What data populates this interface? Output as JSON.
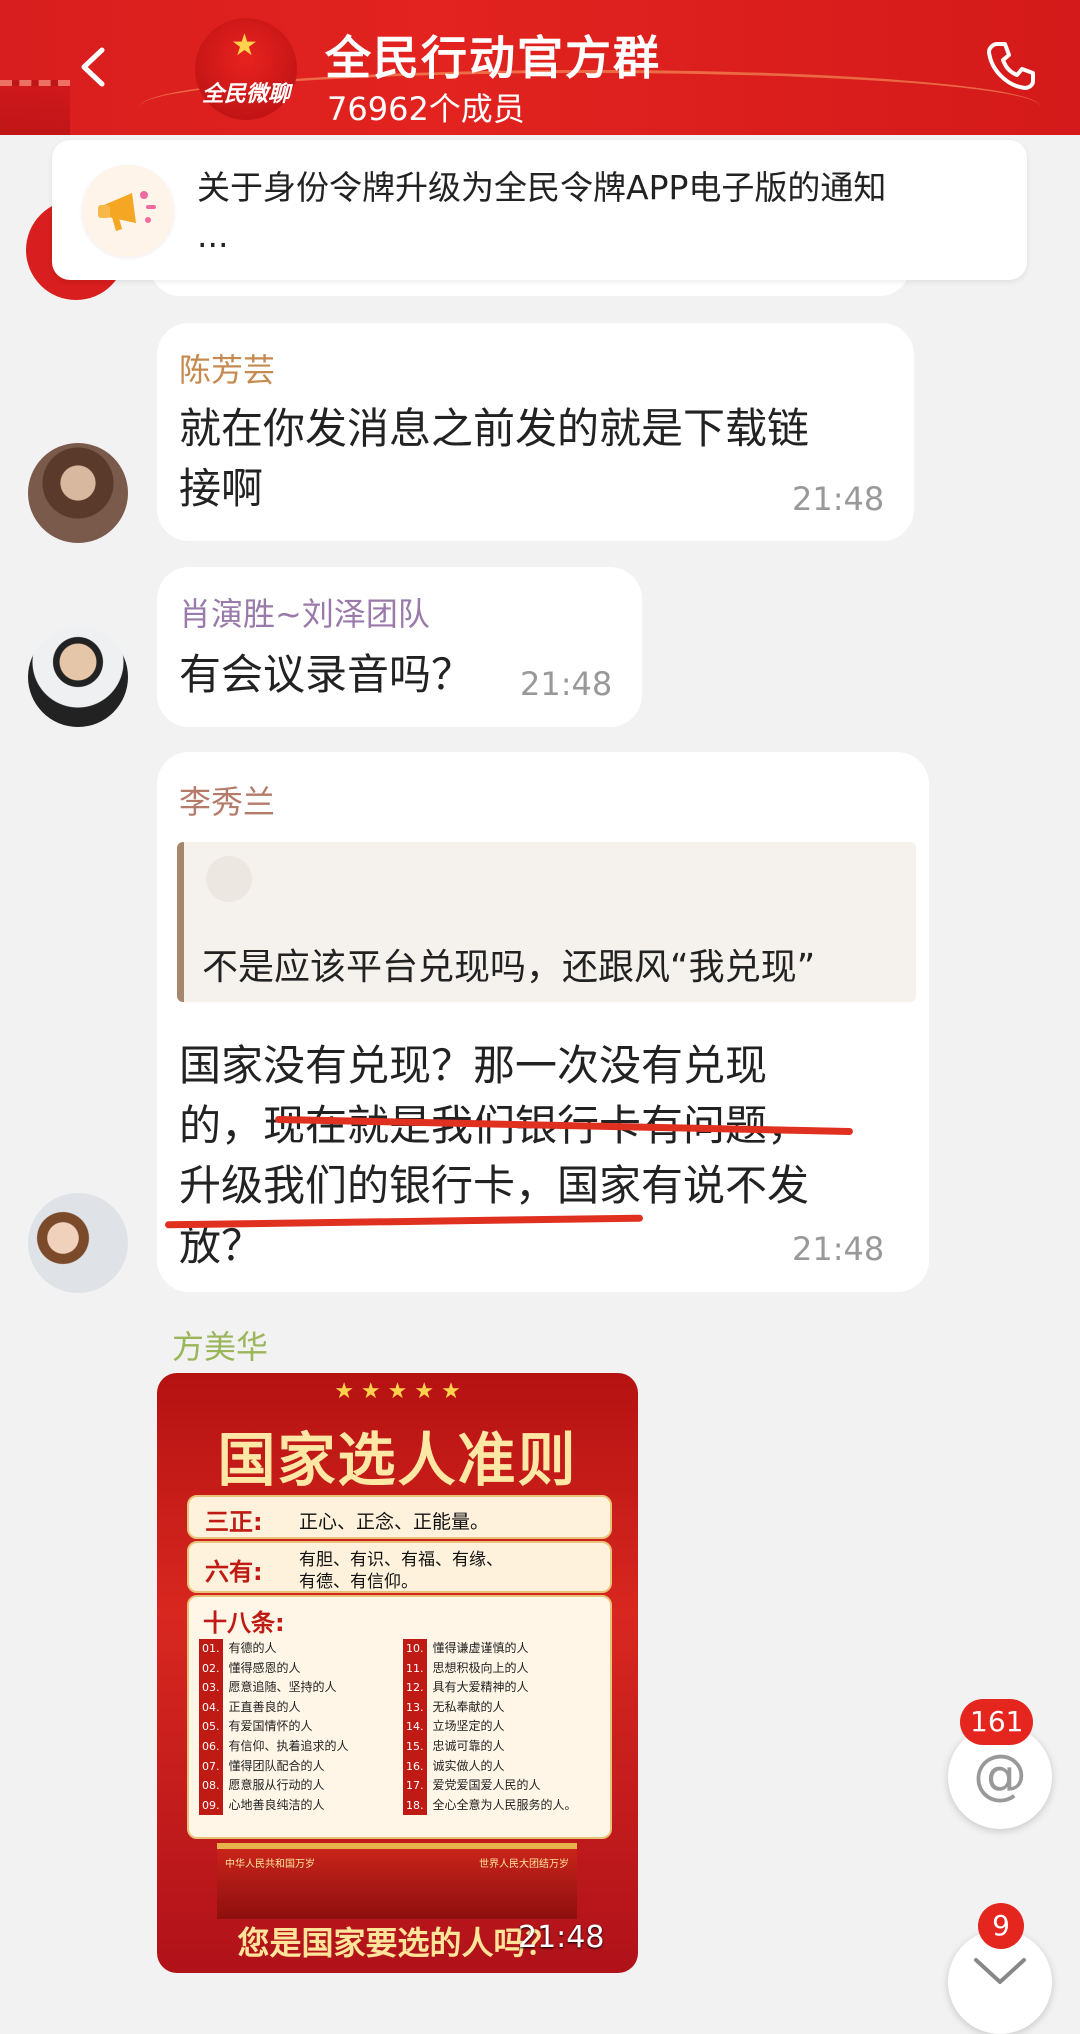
{
  "header": {
    "back_icon": "chevron-left-icon",
    "logo_text": "全民微聊",
    "title": "全民行动官方群",
    "member_count": "76962个成员",
    "phone_icon": "phone-icon",
    "colors": {
      "bar": "#d81e1e",
      "text": "#ffffff"
    }
  },
  "notice": {
    "icon": "megaphone-icon",
    "text": "关于身份令牌升级为全民令牌APP电子版的通知",
    "ellipsis": "..."
  },
  "messages": [
    {
      "sender": "陈芳芸",
      "sender_color": "#c48a4f",
      "lines": [
        "就在你发消息之前发的就是下载链",
        "接啊"
      ],
      "time": "21:48"
    },
    {
      "sender": "肖演胜~刘泽团队",
      "sender_color": "#9a7aaa",
      "text": "有会议录音吗？",
      "time": "21:48"
    },
    {
      "sender": "李秀兰",
      "sender_color": "#b47a6a",
      "quote": "不是应该平台兑现吗，还跟风“我兑现”",
      "lines": [
        "国家没有兑现？那一次没有兑现",
        "的，现在就是我们银行卡有问题，",
        "升级我们的银行卡，国家有说不发",
        "放？"
      ],
      "time": "21:48"
    },
    {
      "sender": "方美华",
      "sender_color": "#9ab55a",
      "time": "21:48",
      "poster": {
        "title": "国家选人准则",
        "san_zheng_label": "三正:",
        "san_zheng_text": "正心、正念、正能量。",
        "liu_you_label": "六有:",
        "liu_you_text_1": "有胆、有识、有福、有缘、",
        "liu_you_text_2": "有德、有信仰。",
        "list_label": "十八条:",
        "items_left": [
          [
            "01.",
            "有德的人"
          ],
          [
            "02.",
            "懂得感恩的人"
          ],
          [
            "03.",
            "愿意追随、坚持的人"
          ],
          [
            "04.",
            "正直善良的人"
          ],
          [
            "05.",
            "有爱国情怀的人"
          ],
          [
            "06.",
            "有信仰、执着追求的人"
          ],
          [
            "07.",
            "懂得团队配合的人"
          ],
          [
            "08.",
            "愿意服从行动的人"
          ],
          [
            "09.",
            "心地善良纯洁的人"
          ]
        ],
        "items_right": [
          [
            "10.",
            "懂得谦虚谨慎的人"
          ],
          [
            "11.",
            "思想积极向上的人"
          ],
          [
            "12.",
            "具有大爱精神的人"
          ],
          [
            "13.",
            "无私奉献的人"
          ],
          [
            "14.",
            "立场坚定的人"
          ],
          [
            "15.",
            "忠诚可靠的人"
          ],
          [
            "16.",
            "诚实做人的人"
          ],
          [
            "17.",
            "爱党爱国爱人民的人"
          ],
          [
            "18.",
            "全心全意为人民服务的人。"
          ]
        ],
        "banner_left": "中华人民共和国万岁",
        "banner_right": "世界人民大团结万岁",
        "bottom": "您是国家要选的人吗？"
      }
    }
  ],
  "floating": {
    "mention_icon": "at-sign-icon",
    "mention_symbol": "@",
    "mention_badge": "161",
    "scroll_icon": "chevron-down-icon",
    "scroll_badge": "9"
  }
}
